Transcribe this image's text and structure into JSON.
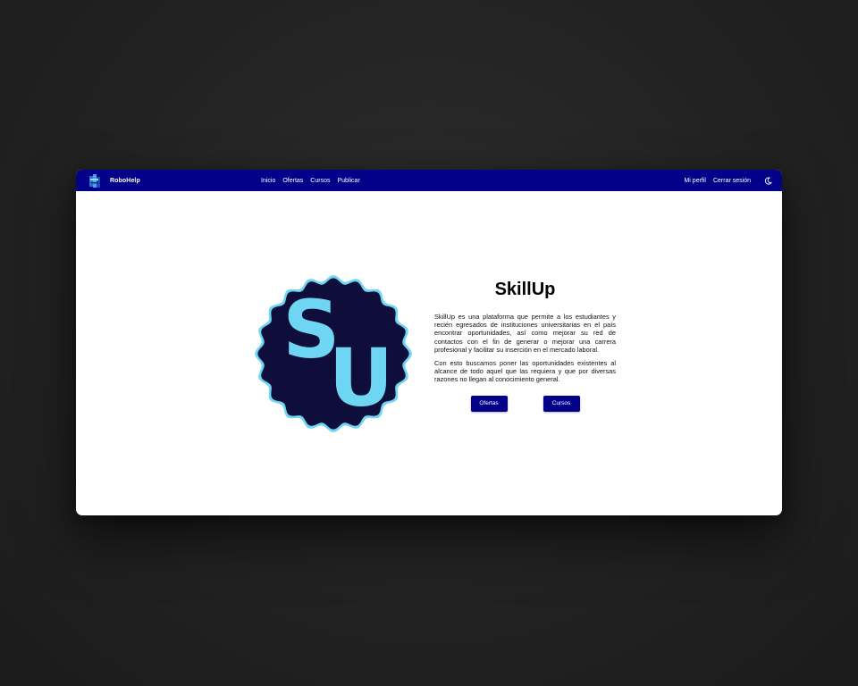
{
  "brand": {
    "name": "RoboHelp",
    "logo_icon": "robot-logo-icon"
  },
  "nav": {
    "links": [
      "Inicio",
      "Ofertas",
      "Cursos",
      "Publicar"
    ],
    "profile": "Mi perfil",
    "logout": "Cerrar sesión",
    "theme_icon": "moon-icon"
  },
  "hero": {
    "logo_icon": "skillup-badge-icon",
    "logo_text": "SU",
    "title": "SkillUp",
    "paragraph_1": "SkillUp es una plataforma que permite a los estudiantes y recién egresados de instituciones universitarias en el país encontrar oportunidades, así como mejorar su red de contactos con el fin de generar o mejorar una carrera profesional y facilitar su inserción en el mercado laboral.",
    "paragraph_2": "Con esto buscamos poner las oportunidades existentes al alcance de todo aquel que las requiera y que por diversas razones no llegan al conocimiento general.",
    "buttons": [
      "Ofertas",
      "Cursos"
    ]
  },
  "colors": {
    "backdrop": "#222222",
    "navbar": "#03008a",
    "badge_fill": "#0f0d3a",
    "badge_accent": "#6ed6f2",
    "button": "#03008a"
  }
}
